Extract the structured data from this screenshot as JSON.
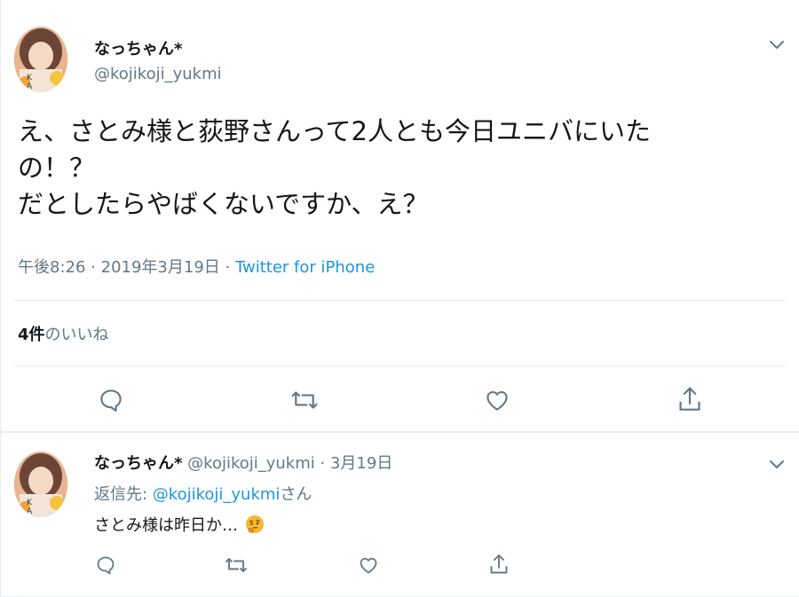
{
  "tweet": {
    "display_name": "なっちゃん*",
    "handle": "@kojikoji_yukmi",
    "text_line1": "え、さとみ様と荻野さんって2人とも今日ユニバにいた",
    "text_line2": "の！？",
    "text_line3": "だとしたらやばくないですか、え？",
    "time": "午後8:26",
    "date": "2019年3月19日",
    "dot": "·",
    "source": "Twitter for iPhone",
    "likes_count": "4件",
    "likes_label": "のいいね"
  },
  "reply": {
    "display_name": "なっちゃん*",
    "handle": "@kojikoji_yukmi",
    "dot": "·",
    "date": "3月19日",
    "reply_to_prefix": "返信先: ",
    "reply_to_handle": "@kojikoji_yukmi",
    "reply_to_suffix": "さん",
    "text": "さとみ様は昨日か…",
    "emoji": "thinking-face"
  },
  "icons": {
    "menu": "chevron-down-icon",
    "reply": "reply-icon",
    "retweet": "retweet-icon",
    "like": "heart-icon",
    "share": "share-icon"
  },
  "colors": {
    "text": "#14171a",
    "secondary": "#657786",
    "link": "#1b95e0",
    "divider": "#e6ecf0"
  }
}
